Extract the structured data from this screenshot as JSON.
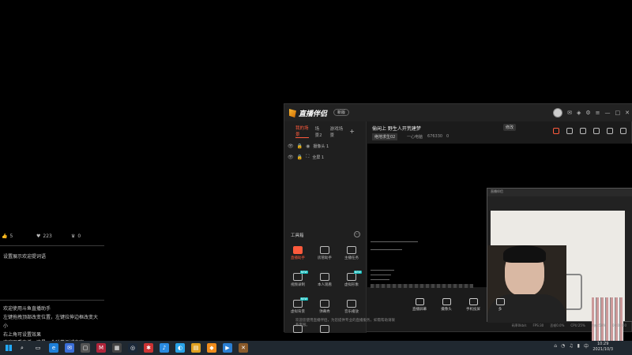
{
  "left_panel": {
    "stats": [
      {
        "icon": "thumbs-up-icon",
        "value": "5"
      },
      {
        "icon": "heart-icon",
        "value": "223"
      },
      {
        "icon": "crown-icon",
        "value": "0"
      }
    ],
    "note": "设置展示欢迎提词语",
    "chat_lines": [
      "欢迎使用斗鱼直播助手",
      "左键拖拽顶部改变位置，左键拉伸边框改变大",
      "小",
      "右上角可设置效果",
      "欢迎观看直播，这是一个弹幕测试内容"
    ]
  },
  "app": {
    "name": "直播伴侣",
    "version_badge": "新版",
    "scene_tabs": [
      "我的场景",
      "场景2",
      "游戏场景"
    ],
    "add_scene": "+",
    "sources": [
      {
        "label": "摄像头 1"
      },
      {
        "label": "全屏 1"
      }
    ],
    "tools_label": "工具箱",
    "tools": [
      {
        "label": "直播助手",
        "active": true
      },
      {
        "label": "房管助手",
        "active": false
      },
      {
        "label": "主播任务",
        "active": false
      },
      {
        "label": "视频录制",
        "active": false,
        "badge": "NEW"
      },
      {
        "label": "本人观看",
        "active": false
      },
      {
        "label": "虚拟形象",
        "active": false,
        "badge": "NEW"
      },
      {
        "label": "虚拟背景",
        "active": false,
        "badge": "NEW"
      },
      {
        "label": "弹幕秀",
        "active": false
      },
      {
        "label": "音乐播放",
        "active": false
      },
      {
        "label": "红包",
        "active": false
      },
      {
        "label": "下载",
        "active": false
      }
    ],
    "room_title": "偷闲上 野生人开荒建梦",
    "room_tag_button": "修改",
    "category_chip": "绝地求生02",
    "meta_items": [
      "一心电脑",
      "676330",
      "0"
    ],
    "pip_title": "直播伴侣",
    "bottom_tools": [
      "直播屏幕",
      "摄像头",
      "手机投屏",
      "多"
    ],
    "notice": "欢迎您使用直播伴侣，为您提供专业的直播服务，如需帮助请联系客服。",
    "status_items": [
      "码率0kb/s",
      "FPS:30",
      "丢帧0.0%",
      "CPU:25%",
      "内存:58%",
      "00:00:00"
    ]
  },
  "taskbar": {
    "time": "10:29",
    "date": "2021/10/3",
    "apps": [
      "edge-icon",
      "mail-icon",
      "terminal-icon",
      "game-icon",
      "media-icon",
      "steam-icon",
      "chat-icon",
      "music-icon",
      "app-icon",
      "folder-icon",
      "douyu-icon",
      "stream-icon",
      "video-icon",
      "tools-icon"
    ]
  }
}
